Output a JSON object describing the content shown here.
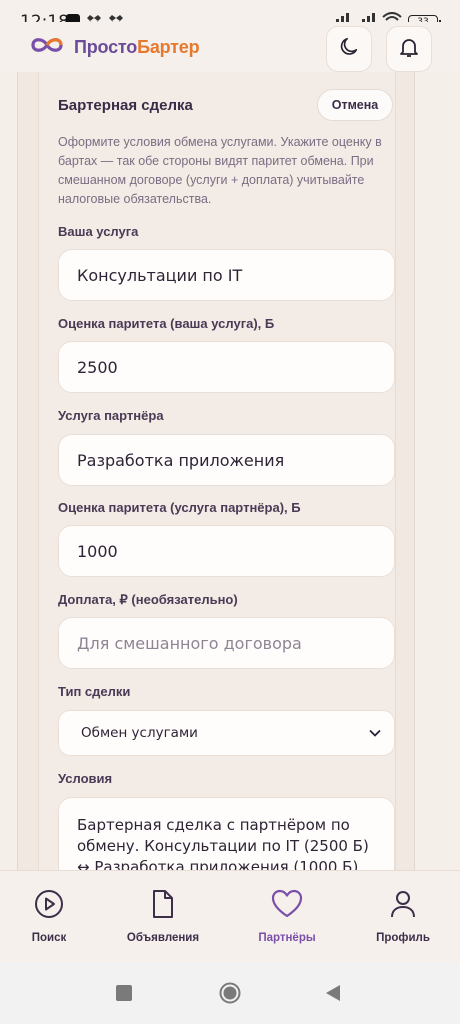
{
  "status": {
    "time": "12:18",
    "battery": "33"
  },
  "app": {
    "name_part1": "Просто",
    "name_part2": "Бартер"
  },
  "form": {
    "title": "Бартерная сделка",
    "cancel_label": "Отмена",
    "hint": "Оформите условия обмена услугами. Укажите оценку в бартах — так обе стороны видят паритет обмена. При смешанном договоре (услуги + доплата) учитывайте налоговые обязательства.",
    "your_service": {
      "label": "Ваша услуга",
      "value": "Консультации по IT"
    },
    "your_parity": {
      "label": "Оценка паритета (ваша услуга), Б",
      "value": "2500"
    },
    "partner_service": {
      "label": "Услуга партнёра",
      "value": "Разработка приложения"
    },
    "partner_parity": {
      "label": "Оценка паритета (услуга партнёра), Б",
      "value": "1000"
    },
    "surcharge": {
      "label": "Доплата, ₽ (необязательно)",
      "placeholder": "Для смешанного договора"
    },
    "deal_type": {
      "label": "Тип сделки",
      "selected": "Обмен услугами"
    },
    "terms": {
      "label": "Условия",
      "value": "Бартерная сделка с партнёром по обмену. Консультации по IT (2500 Б) ↔ Разработка приложения (1000 Б)"
    }
  },
  "nav": {
    "items": [
      {
        "label": "Поиск",
        "icon": "play-circle-icon"
      },
      {
        "label": "Объявления",
        "icon": "document-icon"
      },
      {
        "label": "Партнёры",
        "icon": "heart-icon"
      },
      {
        "label": "Профиль",
        "icon": "user-icon"
      }
    ],
    "active": "Партнёры"
  },
  "colors": {
    "accent": "#7a4fa8",
    "brand_orange": "#e6792d",
    "background": "#f5efea"
  }
}
